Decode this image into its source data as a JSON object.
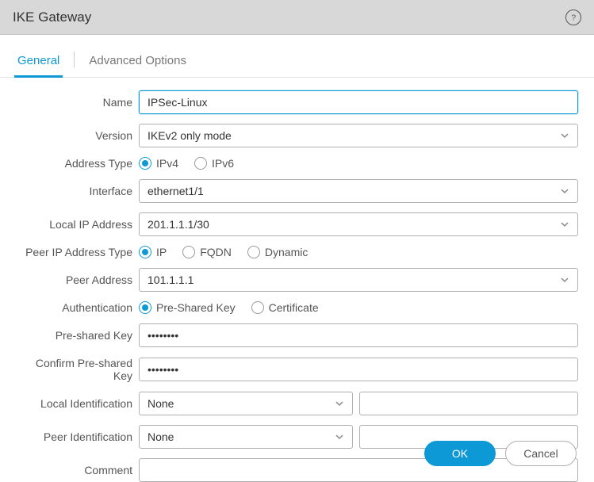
{
  "header": {
    "title": "IKE Gateway"
  },
  "tabs": {
    "general": "General",
    "advanced": "Advanced Options"
  },
  "labels": {
    "name": "Name",
    "version": "Version",
    "address_type": "Address Type",
    "interface": "Interface",
    "local_ip": "Local IP Address",
    "peer_ip_type": "Peer IP Address Type",
    "peer_address": "Peer Address",
    "authentication": "Authentication",
    "psk": "Pre-shared Key",
    "confirm_psk": "Confirm Pre-shared Key",
    "local_ident": "Local Identification",
    "peer_ident": "Peer Identification",
    "comment": "Comment"
  },
  "values": {
    "name": "IPSec-Linux",
    "version": "IKEv2 only mode",
    "interface": "ethernet1/1",
    "local_ip": "201.1.1.1/30",
    "peer_address": "101.1.1.1",
    "psk": "••••••••",
    "confirm_psk": "••••••••",
    "local_ident": "None",
    "local_ident_value": "",
    "peer_ident": "None",
    "peer_ident_value": "",
    "comment": ""
  },
  "radios": {
    "address_type": {
      "ipv4": "IPv4",
      "ipv6": "IPv6"
    },
    "peer_ip_type": {
      "ip": "IP",
      "fqdn": "FQDN",
      "dynamic": "Dynamic"
    },
    "authentication": {
      "psk": "Pre-Shared Key",
      "cert": "Certificate"
    }
  },
  "buttons": {
    "ok": "OK",
    "cancel": "Cancel"
  }
}
